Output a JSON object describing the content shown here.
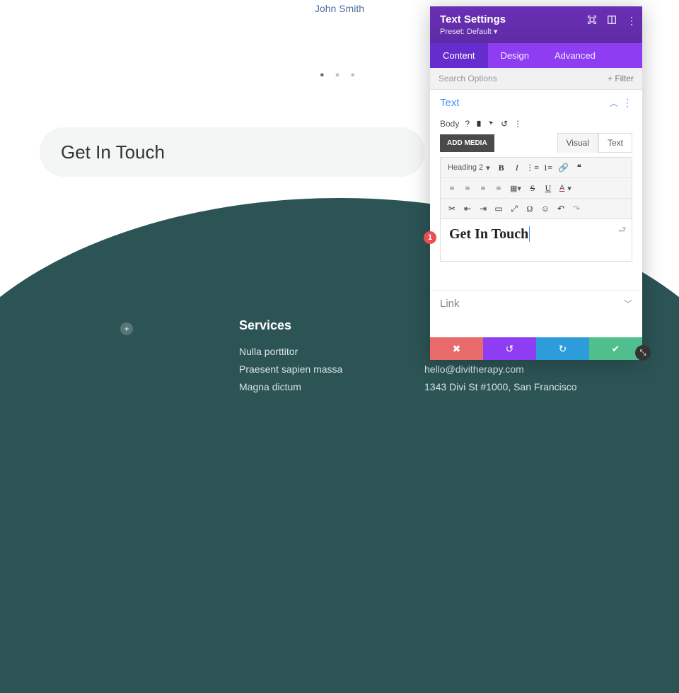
{
  "canvas": {
    "author": "John Smith",
    "pill_text": "Get In Touch",
    "footer": {
      "title": "Services",
      "items": [
        "Nulla porttitor",
        "Praesent sapien massa",
        "Magna dictum"
      ]
    },
    "contact": {
      "email": "hello@divitherapy.com",
      "address": "1343 Divi St #1000, San Francisco"
    }
  },
  "panel": {
    "title": "Text Settings",
    "preset_label": "Preset: Default",
    "tabs": {
      "content": "Content",
      "design": "Design",
      "advanced": "Advanced"
    },
    "search_placeholder": "Search Options",
    "filter_label": "Filter",
    "sections": {
      "text": "Text",
      "link": "Link"
    },
    "body_label": "Body",
    "add_media": "ADD MEDIA",
    "editor_tabs": {
      "visual": "Visual",
      "text": "Text"
    },
    "heading_select": "Heading 2",
    "editor_content": "Get In Touch",
    "badge": "1"
  }
}
